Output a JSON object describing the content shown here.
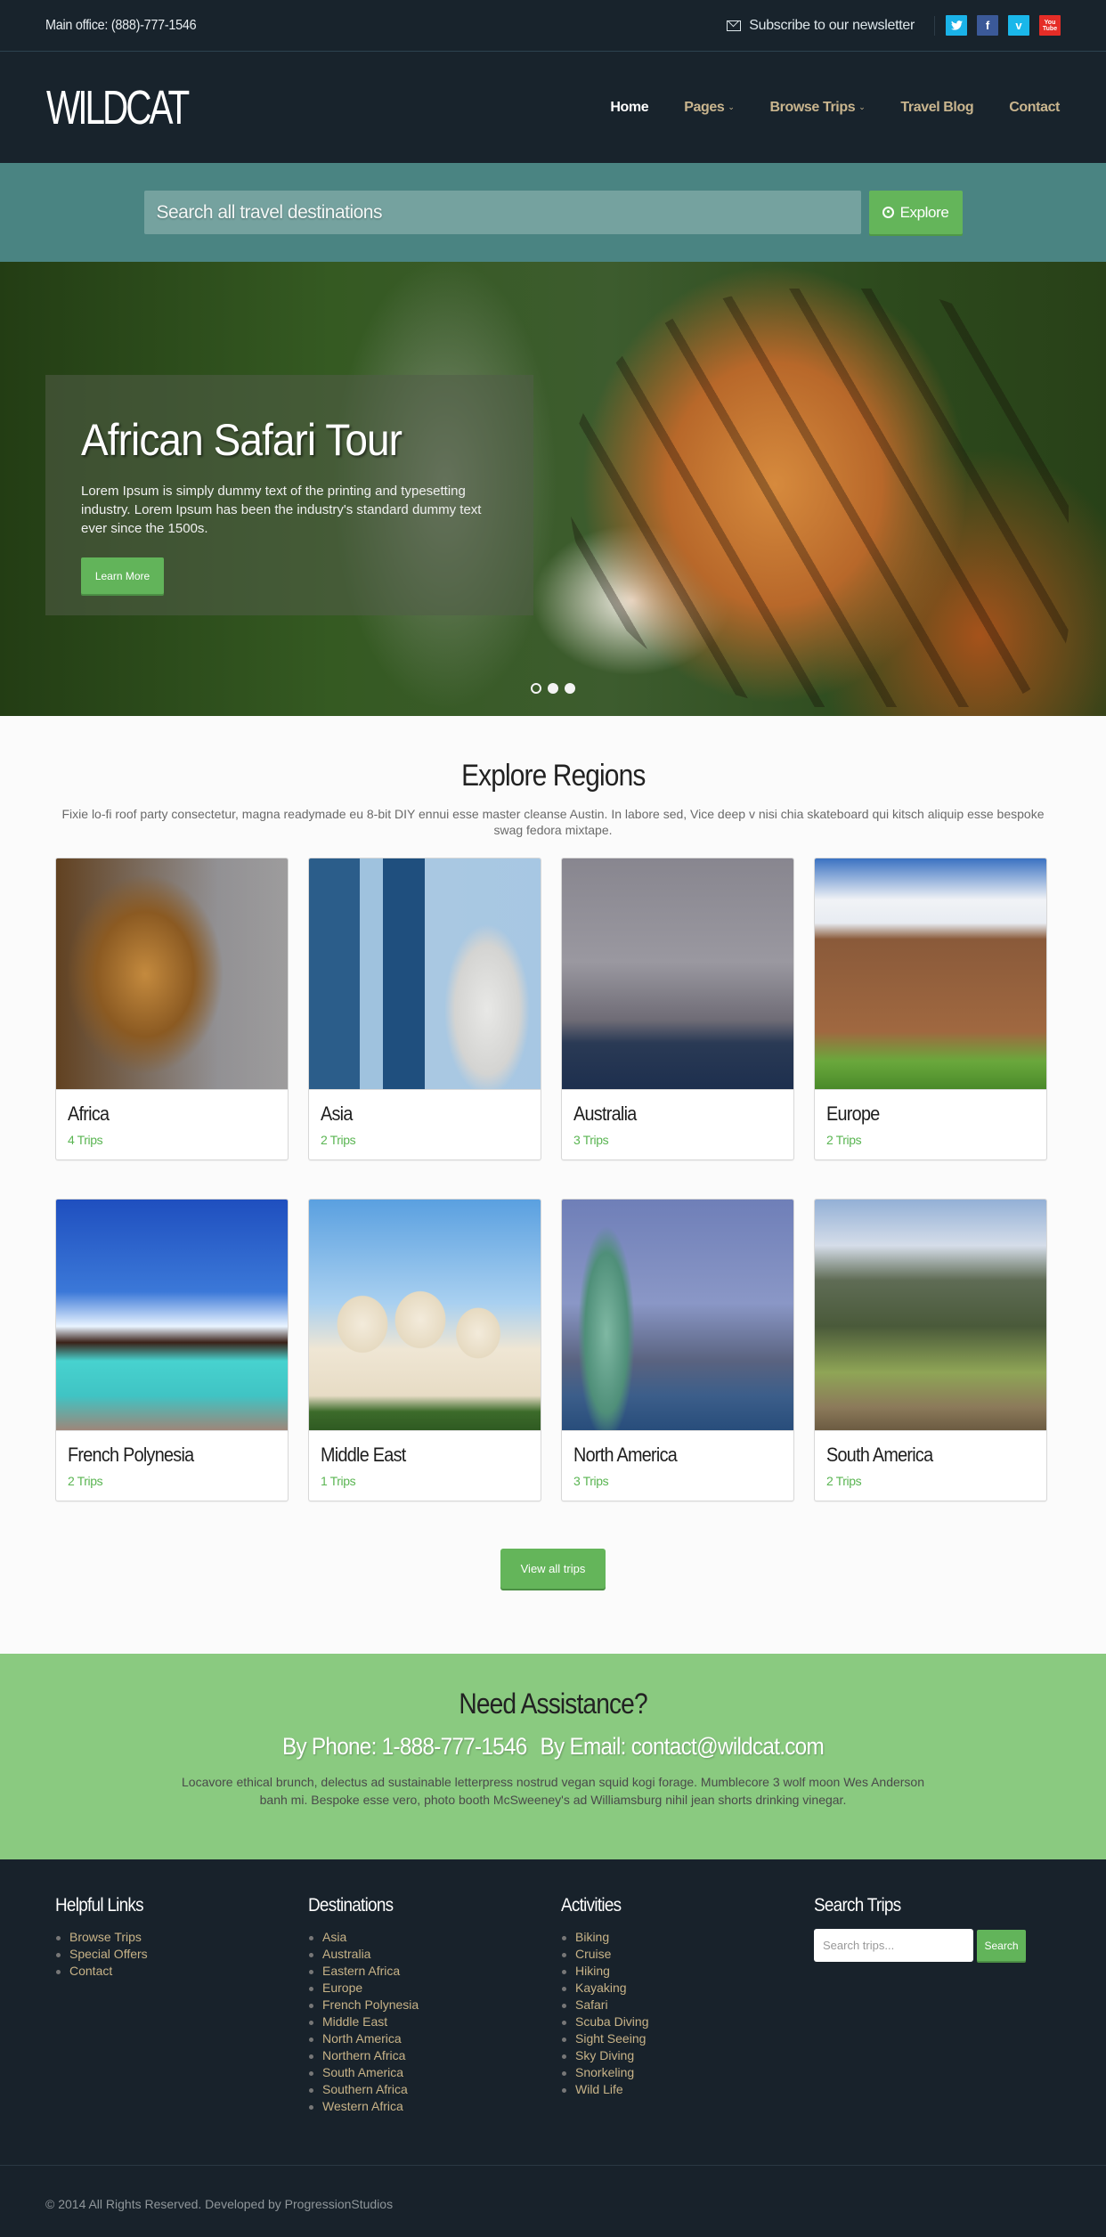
{
  "topbar": {
    "office": "Main office: (888)-777-1546",
    "newsletter": "Subscribe to our newsletter",
    "social": [
      {
        "name": "twitter",
        "glyph": "t",
        "color": "#1ab2e8"
      },
      {
        "name": "facebook",
        "glyph": "f",
        "color": "#3b5998"
      },
      {
        "name": "vimeo",
        "glyph": "v",
        "color": "#1ab7ea"
      },
      {
        "name": "youtube",
        "glyph": "You Tube",
        "color": "#e52d27"
      }
    ]
  },
  "header": {
    "logo": "WILDCAT",
    "nav": [
      {
        "label": "Home",
        "active": true
      },
      {
        "label": "Pages",
        "dropdown": true
      },
      {
        "label": "Browse Trips",
        "dropdown": true
      },
      {
        "label": "Travel Blog"
      },
      {
        "label": "Contact"
      }
    ],
    "caret": "⌄"
  },
  "search": {
    "placeholder": "Search all travel destinations",
    "button": "Explore"
  },
  "hero": {
    "title": "African Safari Tour",
    "text": "Lorem Ipsum is simply dummy text of the printing and typesetting industry. Lorem Ipsum has been the industry's standard dummy text ever since the 1500s.",
    "button": "Learn More",
    "slides": 3,
    "active_slide": 1
  },
  "regions": {
    "title": "Explore Regions",
    "lede": "Fixie lo-fi roof party consectetur, magna readymade eu 8-bit DIY ennui esse master cleanse Austin. In labore sed, Vice deep v nisi chia skateboard qui kitsch aliquip esse bespoke swag fedora mixtape.",
    "items": [
      {
        "name": "Africa",
        "trips": "4 Trips"
      },
      {
        "name": "Asia",
        "trips": "2 Trips"
      },
      {
        "name": "Australia",
        "trips": "3 Trips"
      },
      {
        "name": "Europe",
        "trips": "2 Trips"
      },
      {
        "name": "French Polynesia",
        "trips": "2 Trips"
      },
      {
        "name": "Middle East",
        "trips": "1 Trips"
      },
      {
        "name": "North America",
        "trips": "3 Trips"
      },
      {
        "name": "South America",
        "trips": "2 Trips"
      }
    ],
    "view_all": "View all trips"
  },
  "assist": {
    "title": "Need Assistance?",
    "phone": "By Phone: 1-888-777-1546",
    "email": "By Email: contact@wildcat.com",
    "text": "Locavore ethical brunch, delectus ad sustainable letterpress nostrud vegan squid kogi forage. Mumblecore 3 wolf moon Wes Anderson banh mi. Bespoke esse vero, photo booth McSweeney's ad Williamsburg nihil jean shorts drinking vinegar."
  },
  "footer": {
    "helpful": {
      "title": "Helpful Links",
      "items": [
        "Browse Trips",
        "Special Offers",
        "Contact"
      ]
    },
    "destinations": {
      "title": "Destinations",
      "items": [
        "Asia",
        "Australia",
        "Eastern Africa",
        "Europe",
        "French Polynesia",
        "Middle East",
        "North America",
        "Northern Africa",
        "South America",
        "Southern Africa",
        "Western Africa"
      ]
    },
    "activities": {
      "title": "Activities",
      "items": [
        "Biking",
        "Cruise",
        "Hiking",
        "Kayaking",
        "Safari",
        "Scuba Diving",
        "Sight Seeing",
        "Sky Diving",
        "Snorkeling",
        "Wild Life"
      ]
    },
    "search": {
      "title": "Search Trips",
      "placeholder": "Search trips...",
      "button": "Search"
    },
    "copyright": "© 2014 All Rights Reserved. Developed by ProgressionStudios"
  },
  "colors": {
    "dark": "#18232c",
    "teal": "#4a8482",
    "green": "#64b55a",
    "assist_green": "#8aca80",
    "link_tan": "#c8b387"
  }
}
